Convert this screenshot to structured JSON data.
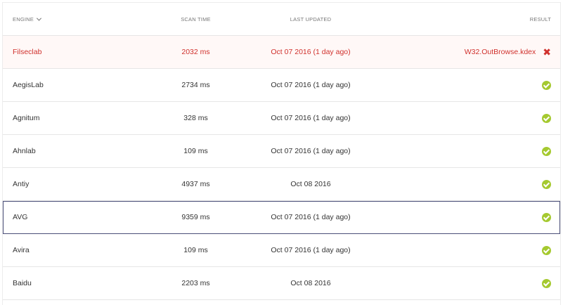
{
  "header": {
    "engine": "ENGINE",
    "scan_time": "SCAN TIME",
    "last_updated": "LAST UPDATED",
    "result": "RESULT"
  },
  "rows": [
    {
      "engine": "Filseclab",
      "scan_time": "2032 ms",
      "last_updated": "Oct 07 2016 (1 day ago)",
      "result": "W32.OutBrowse.kdex",
      "status": "detected"
    },
    {
      "engine": "AegisLab",
      "scan_time": "2734 ms",
      "last_updated": "Oct 07 2016 (1 day ago)",
      "result": "",
      "status": "clean"
    },
    {
      "engine": "Agnitum",
      "scan_time": "328 ms",
      "last_updated": "Oct 07 2016 (1 day ago)",
      "result": "",
      "status": "clean"
    },
    {
      "engine": "Ahnlab",
      "scan_time": "109 ms",
      "last_updated": "Oct 07 2016 (1 day ago)",
      "result": "",
      "status": "clean"
    },
    {
      "engine": "Antiy",
      "scan_time": "4937 ms",
      "last_updated": "Oct 08 2016",
      "result": "",
      "status": "clean"
    },
    {
      "engine": "AVG",
      "scan_time": "9359 ms",
      "last_updated": "Oct 07 2016 (1 day ago)",
      "result": "",
      "status": "clean"
    },
    {
      "engine": "Avira",
      "scan_time": "109 ms",
      "last_updated": "Oct 07 2016 (1 day ago)",
      "result": "",
      "status": "clean"
    },
    {
      "engine": "Baidu",
      "scan_time": "2203 ms",
      "last_updated": "Oct 08 2016",
      "result": "",
      "status": "clean"
    }
  ],
  "colors": {
    "detected": "#d0312d",
    "clean": "#a5c92f",
    "selected_outline": "#4a4e78"
  },
  "icons": {
    "sort": "chevron-down-icon",
    "clean": "check-circle-icon",
    "detected": "close-icon"
  }
}
